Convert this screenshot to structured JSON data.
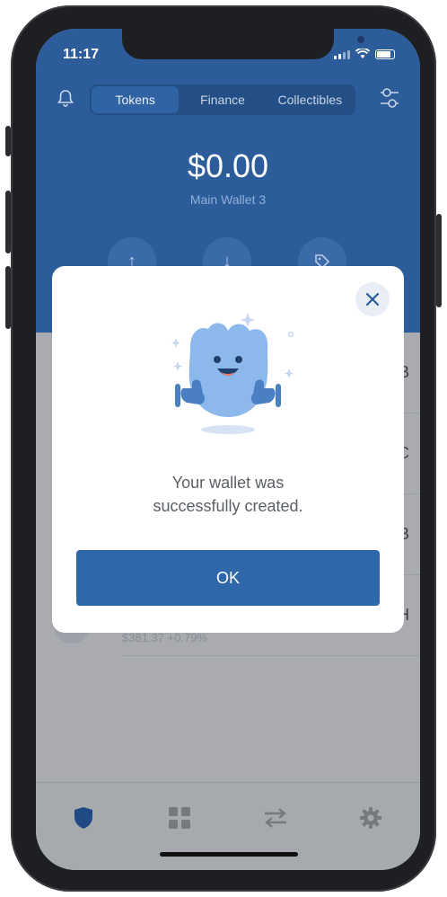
{
  "status_bar": {
    "time": "11:17"
  },
  "tabs": [
    {
      "label": "Tokens",
      "active": true
    },
    {
      "label": "Finance",
      "active": false
    },
    {
      "label": "Collectibles",
      "active": false
    }
  ],
  "wallet": {
    "balance": "$0.00",
    "name": "Main Wallet 3"
  },
  "background_list": {
    "rows": [
      {
        "symbol_fragment": "B"
      },
      {
        "symbol_fragment": "C"
      },
      {
        "symbol_fragment": "B"
      },
      {
        "symbol_fragment": "H"
      }
    ],
    "eth_price_text": "$381.37 +0.79%"
  },
  "modal": {
    "message_line1": "Your wallet was",
    "message_line2": "successfully created.",
    "ok_label": "OK"
  },
  "colors": {
    "header_blue": "#2c5c9a",
    "button_blue": "#2f68aa",
    "overlay_gray": "#a9abb0"
  },
  "icons": {
    "bell": "bell-icon",
    "filter": "filter-sliders-icon",
    "send": "arrow-up-icon",
    "receive": "arrow-down-icon",
    "buy": "tag-icon",
    "close": "close-icon",
    "nav_wallet": "shield-icon",
    "nav_dapps": "grid-icon",
    "nav_dex": "swap-arrows-icon",
    "nav_settings": "gear-icon"
  }
}
